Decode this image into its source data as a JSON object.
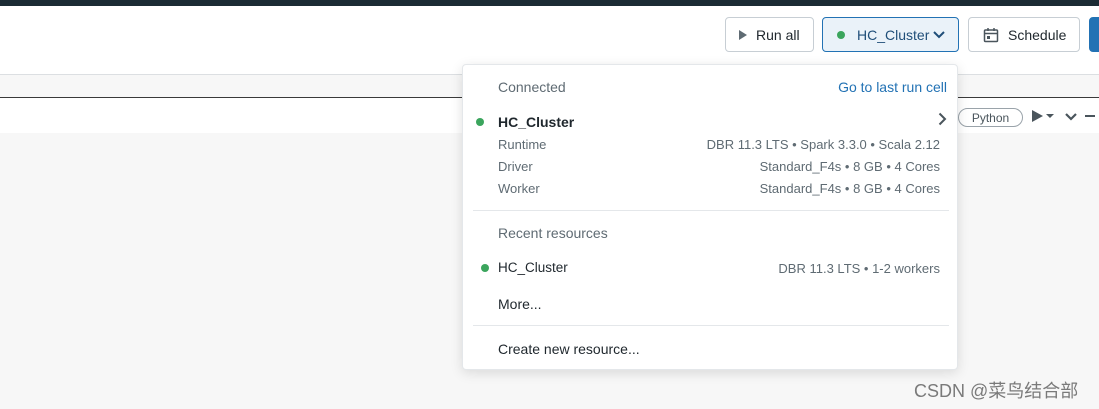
{
  "toolbar": {
    "run_all_label": "Run all",
    "cluster_label": "HC_Cluster",
    "schedule_label": "Schedule"
  },
  "cell": {
    "language": "Python"
  },
  "dropdown": {
    "connected_label": "Connected",
    "go_to_last_run_label": "Go to last run cell",
    "cluster_name": "HC_Cluster",
    "runtime_label": "Runtime",
    "runtime_value": "DBR 11.3 LTS • Spark 3.3.0 • Scala 2.12",
    "driver_label": "Driver",
    "driver_value": "Standard_F4s • 8 GB • 4 Cores",
    "worker_label": "Worker",
    "worker_value": "Standard_F4s • 8 GB • 4 Cores",
    "recent_label": "Recent resources",
    "recent_items": [
      {
        "name": "HC_Cluster",
        "detail": "DBR 11.3 LTS • 1-2 workers"
      }
    ],
    "more_label": "More...",
    "create_label": "Create new resource..."
  },
  "watermark": "CSDN @菜鸟结合部",
  "colors": {
    "status_green": "#3ba55d",
    "accent_blue": "#2272b4"
  }
}
